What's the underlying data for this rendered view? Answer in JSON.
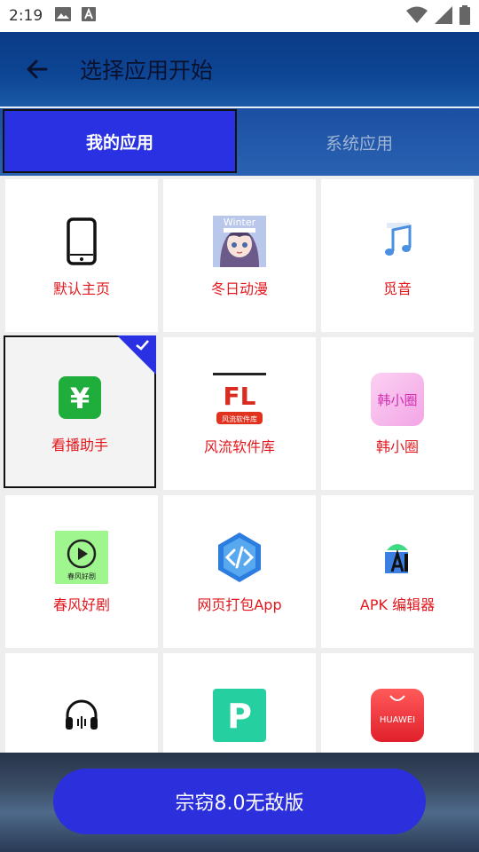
{
  "status": {
    "time": "2:19"
  },
  "header": {
    "title": "选择应用开始"
  },
  "tabs": [
    {
      "label": "我的应用",
      "active": true
    },
    {
      "label": "系统应用",
      "active": false
    }
  ],
  "apps": [
    {
      "label": "默认主页",
      "icon": "phone-icon"
    },
    {
      "label": "冬日动漫",
      "icon": "anime-girl-icon",
      "icon_text": "Winter"
    },
    {
      "label": "觅音",
      "icon": "music-note-icon"
    },
    {
      "label": "看播助手",
      "icon": "yen-icon",
      "icon_text": "¥",
      "selected": true
    },
    {
      "label": "风流软件库",
      "icon": "fl-logo-icon",
      "icon_text": "FL",
      "icon_subtext": "风流软件库"
    },
    {
      "label": "韩小圈",
      "icon": "hanxiaoquan-icon",
      "icon_text": "韩小圈"
    },
    {
      "label": "春风好剧",
      "icon": "play-icon",
      "icon_text": "春风好剧"
    },
    {
      "label": "网页打包App",
      "icon": "code-hexagon-icon"
    },
    {
      "label": "APK 编辑器",
      "icon": "android-ai-icon"
    },
    {
      "label": "",
      "icon": "headphones-icon"
    },
    {
      "label": "",
      "icon": "p-logo-icon",
      "icon_text": "P"
    },
    {
      "label": "",
      "icon": "huawei-icon",
      "icon_text": "HUAWEI"
    }
  ],
  "main_button": {
    "label": "宗窃8.0无敌版"
  },
  "colors": {
    "accent": "#2a31e3",
    "label_red": "#e3171d",
    "appbar": "#0d4695"
  }
}
